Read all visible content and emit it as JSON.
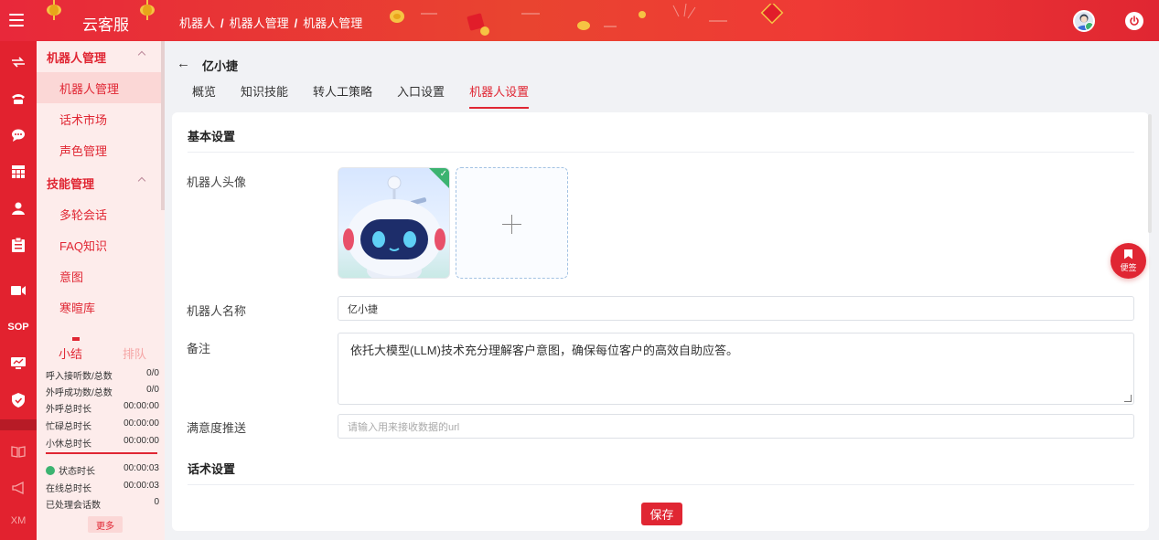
{
  "topbar": {
    "brand": "云客服",
    "breadcrumbs": [
      "机器人",
      "机器人管理",
      "机器人管理"
    ],
    "separator": "/"
  },
  "iconbar": {
    "items": [
      {
        "icon": "transfer-icon"
      },
      {
        "icon": "telephone-icon"
      },
      {
        "icon": "chat-icon"
      },
      {
        "icon": "grid-icon"
      },
      {
        "icon": "user-icon"
      },
      {
        "icon": "clipboard-icon"
      },
      {
        "icon": "video-icon"
      },
      {
        "icon": "sop-icon",
        "text": "SOP"
      },
      {
        "icon": "monitor-icon"
      },
      {
        "icon": "shield-icon"
      },
      {
        "icon": "book-icon"
      },
      {
        "icon": "megaphone-icon"
      },
      {
        "icon": "xm-icon",
        "text": "XM"
      }
    ]
  },
  "sidebar": {
    "groups": [
      {
        "label": "机器人管理",
        "items": [
          "机器人管理",
          "话术市场",
          "声色管理"
        ]
      },
      {
        "label": "技能管理",
        "items": [
          "多轮会话",
          "FAQ知识",
          "意图",
          "寒暄库"
        ]
      }
    ],
    "stats": {
      "tab_summary": "小结",
      "tab_queue": "排队",
      "rows": [
        {
          "label": "呼入接听数/总数",
          "value": "0/0"
        },
        {
          "label": "外呼成功数/总数",
          "value": "0/0"
        },
        {
          "label": "外呼总时长",
          "value": "00:00:00"
        },
        {
          "label": "忙碌总时长",
          "value": "00:00:00"
        },
        {
          "label": "小休总时长",
          "value": "00:00:00"
        }
      ],
      "rows2": [
        {
          "label": "状态时长",
          "value": "00:00:03"
        },
        {
          "label": "在线总时长",
          "value": "00:00:03"
        },
        {
          "label": "已处理会话数",
          "value": "0"
        }
      ],
      "more": "更多"
    }
  },
  "page": {
    "back_arrow": "←",
    "title": "亿小捷",
    "tabs": [
      "概览",
      "知识技能",
      "转人工策略",
      "入口设置",
      "机器人设置"
    ],
    "active_tab": "机器人设置"
  },
  "form": {
    "section_basic": "基本设置",
    "avatar_label": "机器人头像",
    "name_label": "机器人名称",
    "name_value": "亿小捷",
    "remark_label": "备注",
    "remark_value": "依托大模型(LLM)技术充分理解客户意图，确保每位客户的高效自助应答。",
    "satisfaction_label": "满意度推送",
    "satisfaction_placeholder": "请输入用来接收数据的url",
    "section_script": "话术设置",
    "save": "保存"
  },
  "float_note": "便签",
  "colors": {
    "brand_red": "#e02633",
    "sidebar_bg": "#fdeceb",
    "online_green": "#3cb371"
  }
}
